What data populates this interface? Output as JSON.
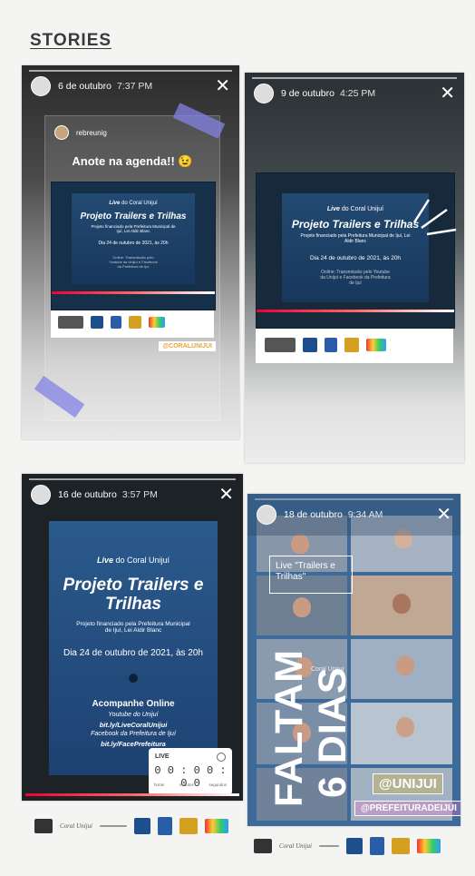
{
  "page": {
    "heading": "STORIES"
  },
  "stories": [
    {
      "date": "6 de outubro",
      "time": "7:37 PM",
      "user": "rebreunig",
      "caption": "Anote na agenda!! 😉",
      "mention": "@CORALUNIJUI",
      "close": "✕"
    },
    {
      "date": "9 de outubro",
      "time": "4:25 PM",
      "close": "✕"
    },
    {
      "date": "16 de outubro",
      "time": "3:57 PM",
      "close": "✕",
      "timer": {
        "label": "LIVE",
        "digits": "0 0 : 0 0 : 0 0",
        "units": [
          "horas",
          "minutos",
          "segundos"
        ]
      }
    },
    {
      "date": "18 de outubro",
      "time": "9:34 AM",
      "close": "✕",
      "live_box": "Live \"Trailers e Trilhas\"",
      "big_text_1": "FALTAM",
      "big_text_2": "6 DIAS",
      "tag1": "@UNIJUI",
      "tag2": "@PREFEITURADEIJUI",
      "coral": "Coral Unijuí"
    }
  ],
  "poster": {
    "live_prefix": "Live",
    "live_suffix": "do Coral Unijuí",
    "title": "Projeto Trailers e Trilhas",
    "subtitle": "Projeto financiado pela Prefeitura Municipal de Ijuí, Lei Aldir Blanc",
    "date": "Dia 24 de outubro de 2021, às 20h",
    "online_title": "Acompanhe Online",
    "online_1": "Youtube do Unijuí",
    "online_2": "bit.ly/LiveCoralUnijui",
    "online_3": "Facebook da Prefeitura de Ijuí",
    "online_4": "bit.ly/FacePrefeitura",
    "small_online": "Online: Transmissão pelo Youtube da Unijuí e Facebook da Prefeitura de Ijuí",
    "coral_logo": "Coral Unijuí"
  }
}
